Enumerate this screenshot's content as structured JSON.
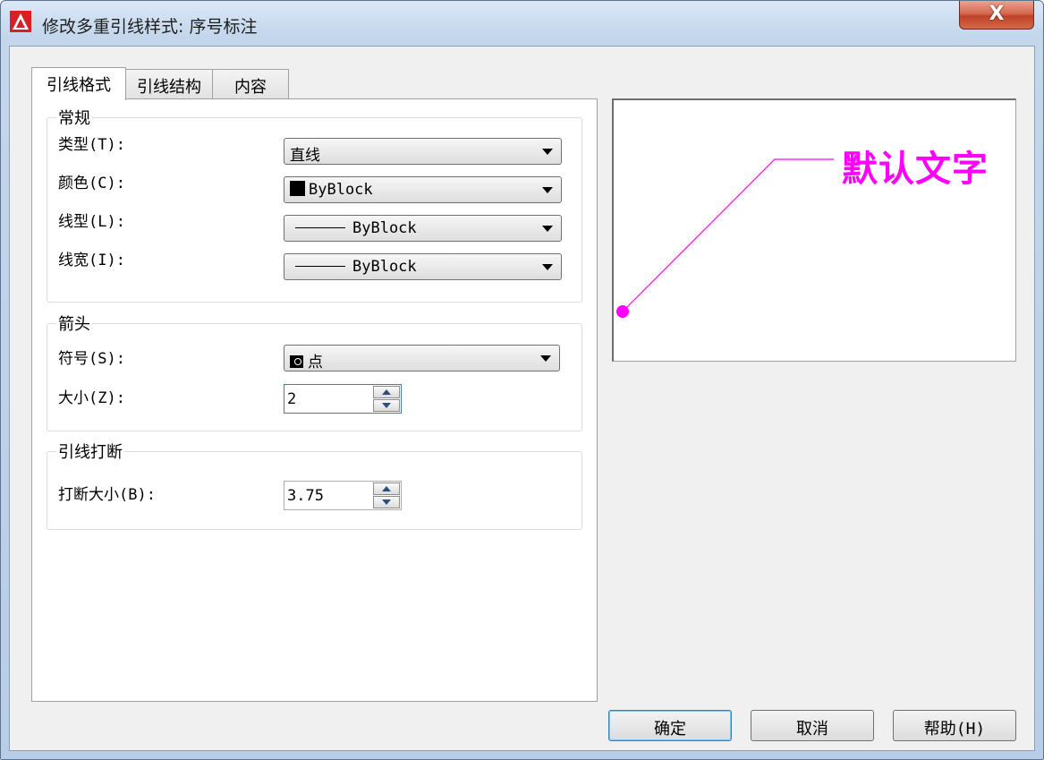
{
  "window": {
    "title": "修改多重引线样式: 序号标注",
    "close_label": "X"
  },
  "tabs": [
    {
      "label": "引线格式",
      "active": true
    },
    {
      "label": "引线结构",
      "active": false
    },
    {
      "label": "内容",
      "active": false
    }
  ],
  "general": {
    "title": "常规",
    "type_label": "类型(T):",
    "type_value": "直线",
    "color_label": "颜色(C):",
    "color_value": "ByBlock",
    "linetype_label": "线型(L):",
    "linetype_value": "ByBlock",
    "lineweight_label": "线宽(I):",
    "lineweight_value": "ByBlock"
  },
  "arrowhead": {
    "title": "箭头",
    "symbol_label": "符号(S):",
    "symbol_value": "点",
    "size_label": "大小(Z):",
    "size_value": "2"
  },
  "leader_break": {
    "title": "引线打断",
    "break_size_label": "打断大小(B):",
    "break_size_value": "3.75"
  },
  "preview": {
    "text": "默认文字",
    "color": "#ff00ff"
  },
  "buttons": {
    "ok": "确定",
    "cancel": "取消",
    "help": "帮助(H)"
  },
  "icons": [
    "autocad-app-icon",
    "close-icon",
    "dropdown-arrow-icon",
    "spin-up-icon",
    "spin-down-icon",
    "color-swatch-icon",
    "dot-arrow-icon"
  ]
}
